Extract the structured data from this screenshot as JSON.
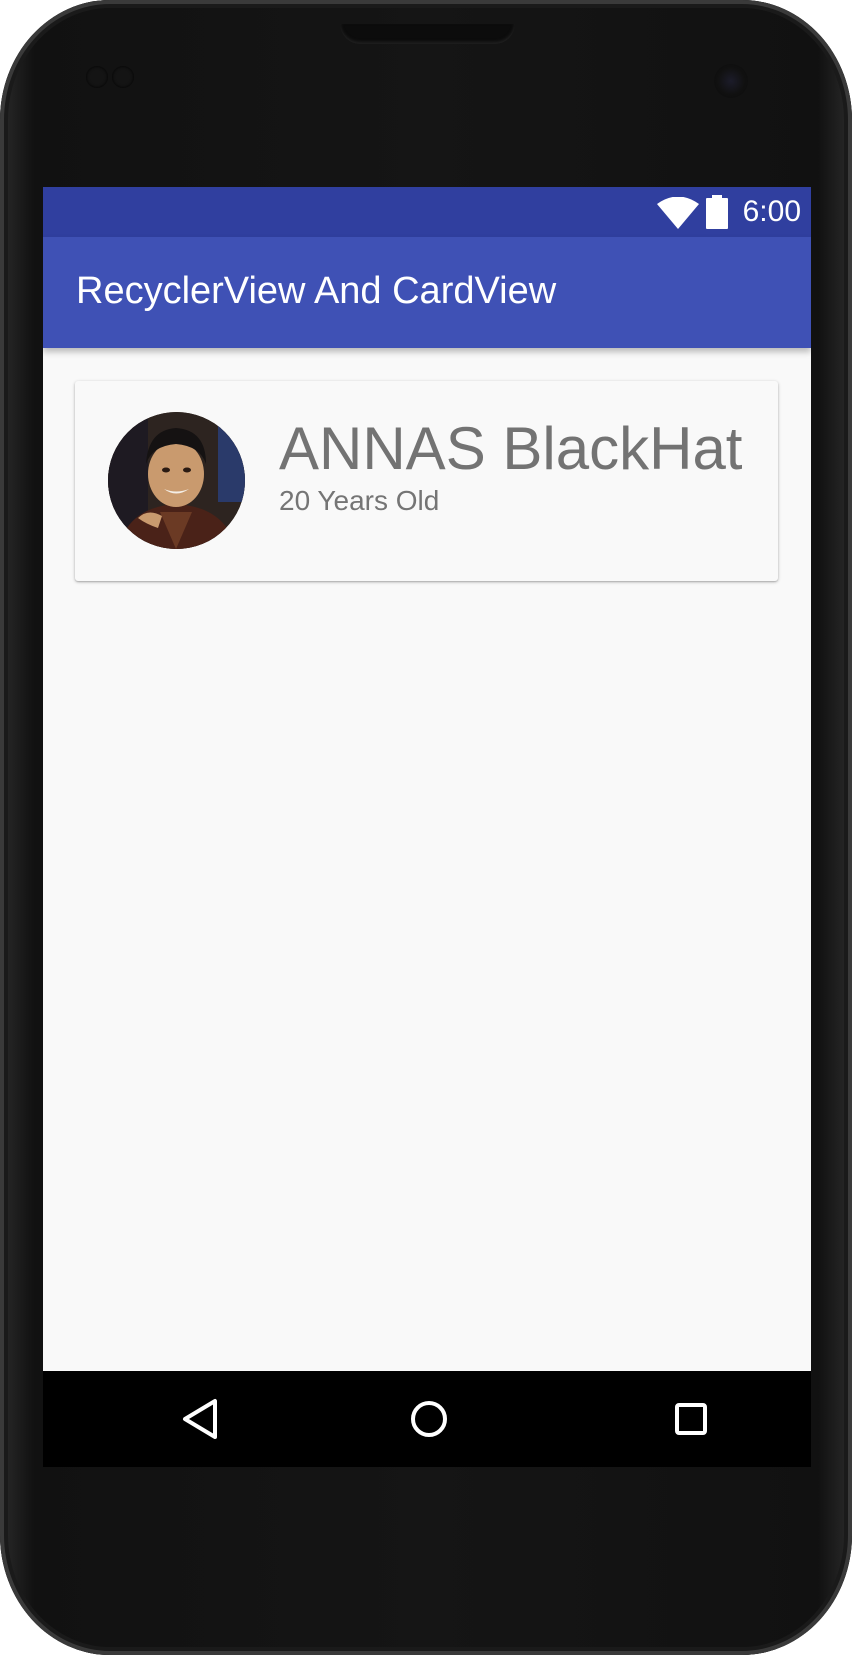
{
  "status_bar": {
    "time": "6:00",
    "wifi_icon": "wifi-icon",
    "battery_icon": "battery-icon"
  },
  "app_bar": {
    "title": "RecyclerView And CardView"
  },
  "cards": [
    {
      "avatar_icon": "avatar-photo",
      "name": "ANNAS BlackHat",
      "age": "20 Years Old"
    }
  ],
  "nav_bar": {
    "back_icon": "back-triangle-icon",
    "home_icon": "home-circle-icon",
    "recents_icon": "recents-square-icon"
  },
  "colors": {
    "status_bar": "#303f9f",
    "app_bar": "#3f51b5",
    "background": "#f9f9f9",
    "text_secondary": "#737373"
  }
}
